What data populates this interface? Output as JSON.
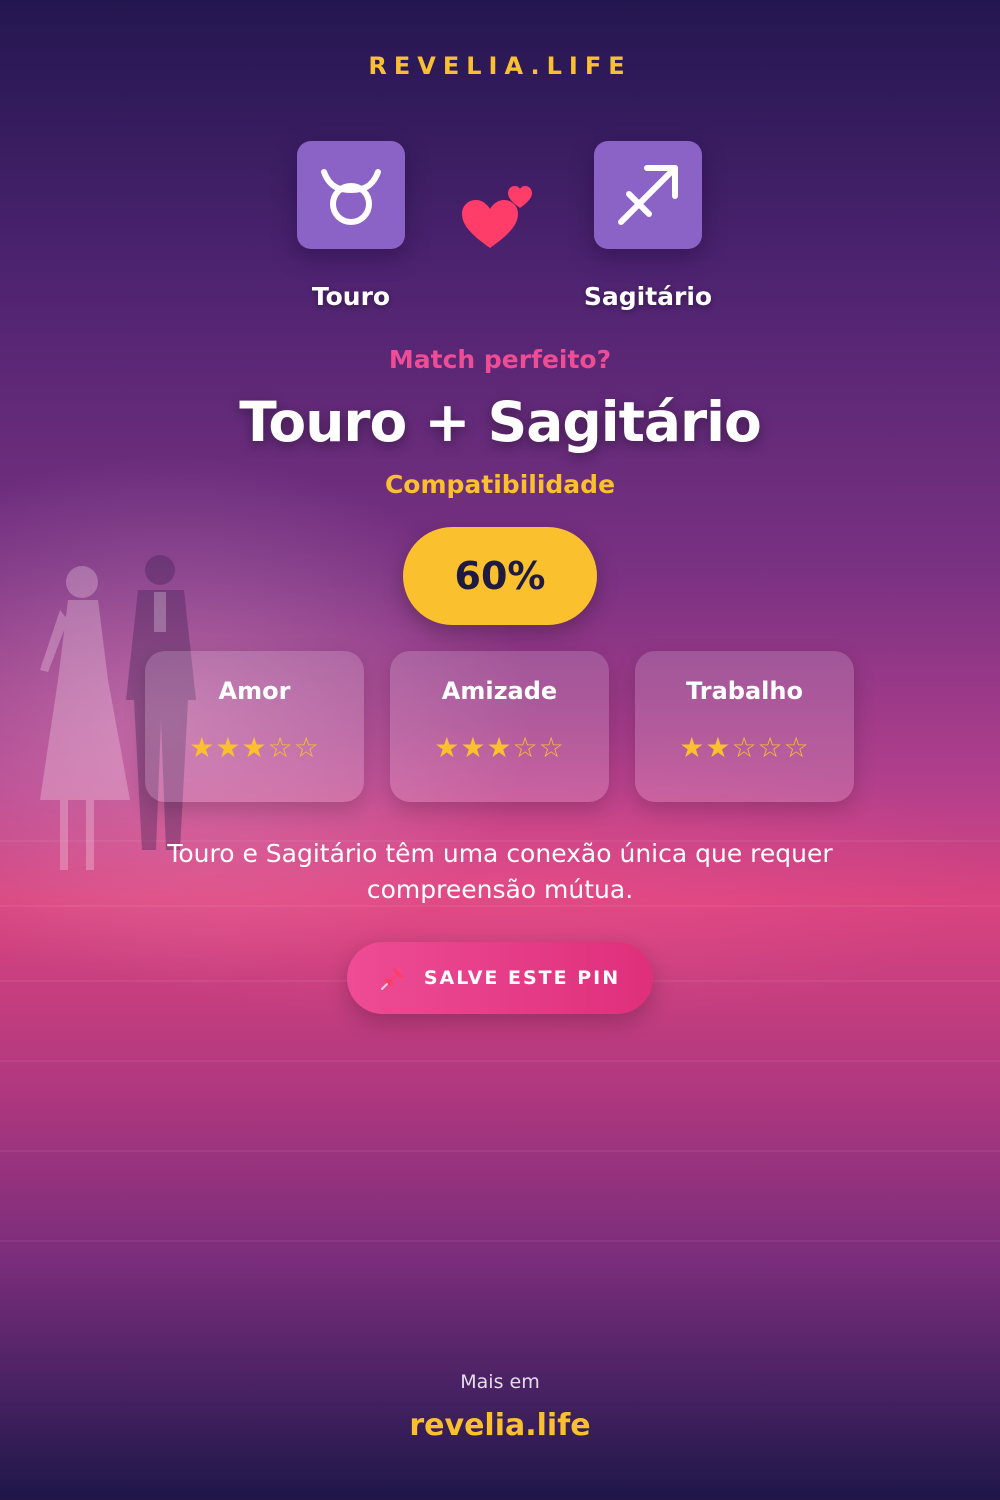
{
  "brand": "REVELIA.LIFE",
  "signs": [
    {
      "name": "Touro",
      "icon": "taurus-icon"
    },
    {
      "name": "Sagitário",
      "icon": "sagittarius-icon"
    }
  ],
  "match_question": "Match perfeito?",
  "title": "Touro + Sagitário",
  "subtitle": "Compatibilidade",
  "percentage": "60%",
  "categories": [
    {
      "label": "Amor",
      "rating": 3,
      "max": 5,
      "stars": "★★★☆☆"
    },
    {
      "label": "Amizade",
      "rating": 3,
      "max": 5,
      "stars": "★★★☆☆"
    },
    {
      "label": "Trabalho",
      "rating": 2,
      "max": 5,
      "stars": "★★☆☆☆"
    }
  ],
  "description": "Touro e Sagitário têm uma conexão única que requer compreensão mútua.",
  "cta": {
    "label": "SALVE ESTE PIN",
    "icon": "pushpin-icon"
  },
  "footer": {
    "more": "Mais em",
    "site": "revelia.life"
  },
  "colors": {
    "accent": "#fbc02d",
    "pink": "#ee4c95",
    "sign_box": "#8b62c6",
    "heart": "#ff3d68"
  }
}
